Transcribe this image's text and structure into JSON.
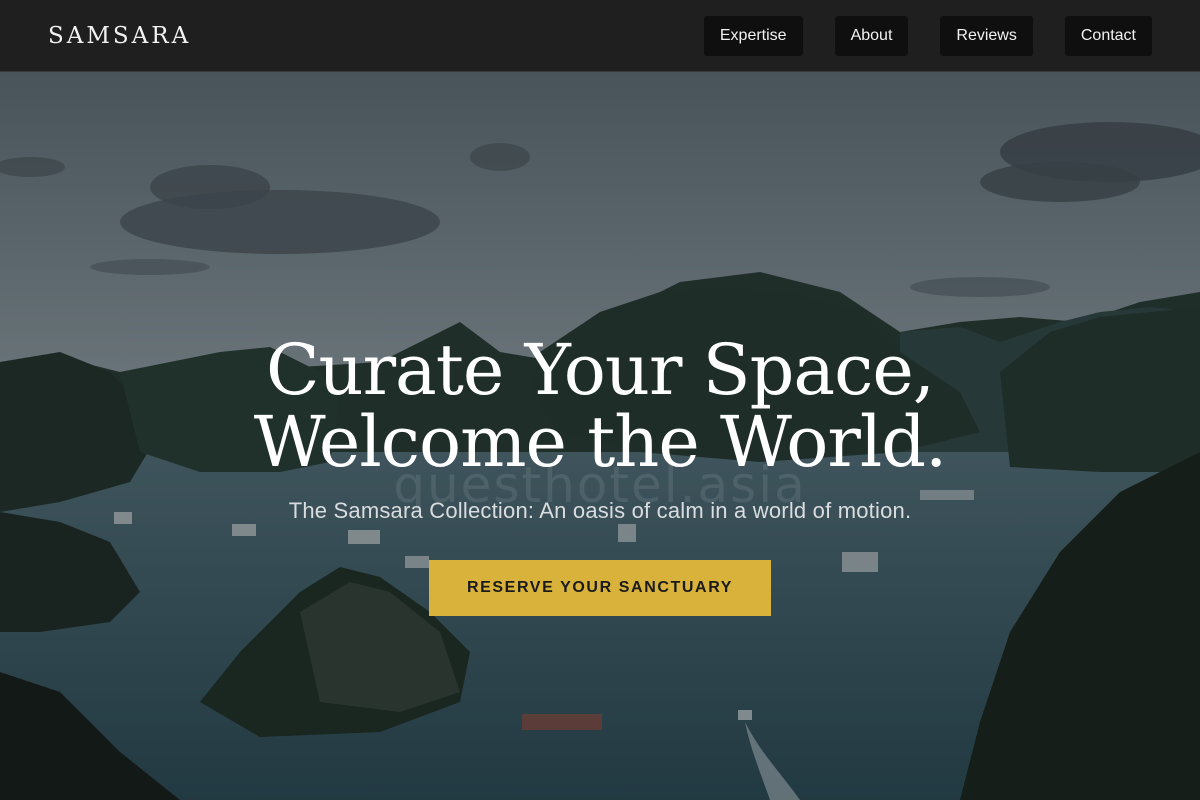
{
  "header": {
    "brand": "SAMSARA",
    "nav": [
      {
        "label": "Expertise"
      },
      {
        "label": "About"
      },
      {
        "label": "Reviews"
      },
      {
        "label": "Contact"
      }
    ]
  },
  "hero": {
    "title_line1": "Curate Your Space,",
    "title_line2": "Welcome the World.",
    "subtitle": "The Samsara Collection: An oasis of calm in a world of motion.",
    "watermark": "questhotel.asia",
    "cta_label": "RESERVE YOUR SANCTUARY"
  },
  "colors": {
    "header_bg": "#1f1f1f",
    "nav_button_bg": "#0f0f0f",
    "cta_bg": "#d8b23a",
    "text_light": "#ffffff"
  }
}
